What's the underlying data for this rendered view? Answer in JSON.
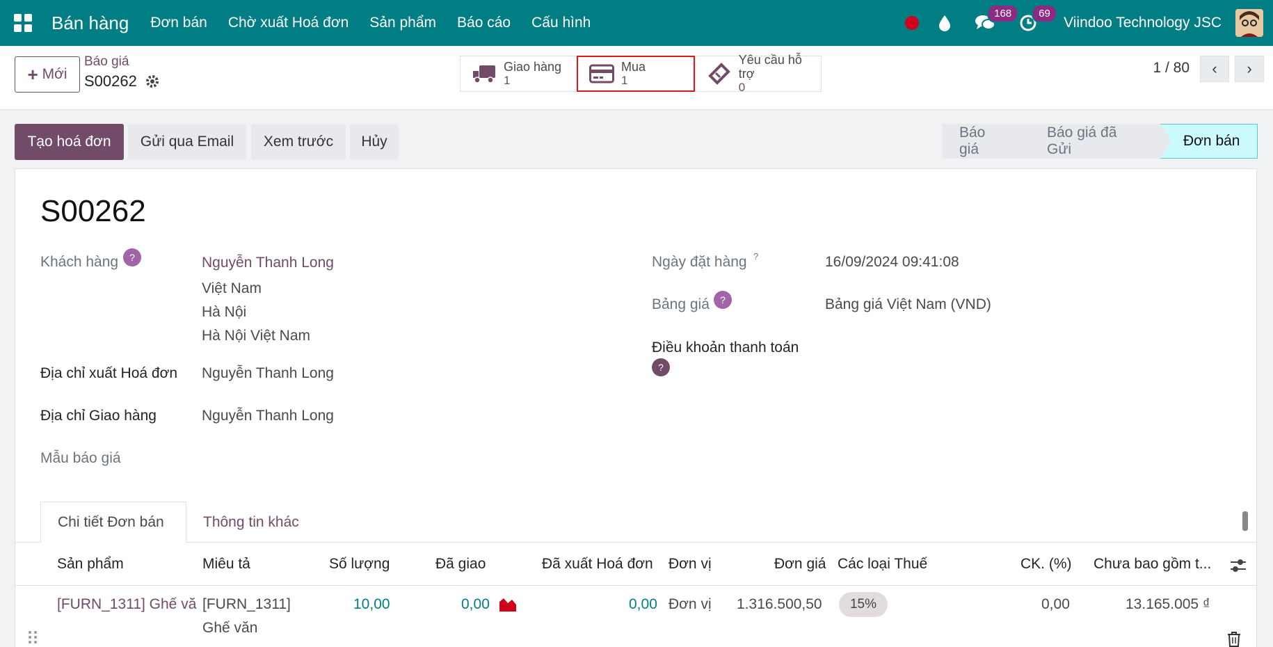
{
  "navbar": {
    "brand": "Bán hàng",
    "menu": [
      "Đơn bán",
      "Chờ xuất Hoá đơn",
      "Sản phẩm",
      "Báo cáo",
      "Cấu hình"
    ],
    "messages_badge": "168",
    "activities_badge": "69",
    "company": "Viindoo Technology JSC",
    "accent": "#017e84"
  },
  "control": {
    "new_label": "Mới",
    "breadcrumb_parent": "Báo giá",
    "breadcrumb_current": "S00262",
    "smart_buttons": [
      {
        "label": "Giao hàng",
        "value": "1",
        "icon": "truck-icon"
      },
      {
        "label": "Mua",
        "value": "1",
        "icon": "credit-card-icon"
      },
      {
        "label": "Yêu cầu hỗ trợ",
        "value": "0",
        "icon": "ticket-icon"
      }
    ],
    "pager": "1 / 80"
  },
  "actions": {
    "create_invoice": "Tạo hoá đơn",
    "send_email": "Gửi qua Email",
    "preview": "Xem trước",
    "cancel": "Hủy"
  },
  "status_stages": [
    "Báo giá",
    "Báo giá đã Gửi",
    "Đơn bán"
  ],
  "record": {
    "name": "S00262",
    "customer_label": "Khách hàng",
    "customer_name": "Nguyễn Thanh Long",
    "customer_address": [
      "Việt Nam",
      "Hà Nội",
      "Hà Nội Việt Nam"
    ],
    "invoice_address_label": "Địa chỉ xuất Hoá đơn",
    "invoice_address": "Nguyễn Thanh Long",
    "delivery_address_label": "Địa chỉ Giao hàng",
    "delivery_address": "Nguyễn Thanh Long",
    "quote_template_label": "Mẫu báo giá",
    "order_date_label": "Ngày đặt hàng",
    "order_date": "16/09/2024 09:41:08",
    "pricelist_label": "Bảng giá",
    "pricelist": "Bảng giá Việt Nam (VND)",
    "payment_terms_label": "Điều khoản thanh toán",
    "help_mark": "?"
  },
  "tabs": [
    "Chi tiết Đơn bán",
    "Thông tin khác"
  ],
  "table": {
    "headers": [
      "Sản phẩm",
      "Miêu tả",
      "Số lượng",
      "Đã giao",
      "Đã xuất Hoá đơn",
      "Đơn vị",
      "Đơn giá",
      "Các loại Thuế",
      "CK. (%)",
      "Chưa bao gồm t..."
    ],
    "rows": [
      {
        "product": "[FURN_1311] Ghế vă",
        "description": [
          "[FURN_1311]",
          "Ghế văn"
        ],
        "quantity": "10,00",
        "delivered": "0,00",
        "invoiced": "0,00",
        "uom": "Đơn vị",
        "unit_price": "1.316.500,50",
        "tax": "15%",
        "discount": "0,00",
        "subtotal": "13.165.005 ₫"
      }
    ]
  }
}
